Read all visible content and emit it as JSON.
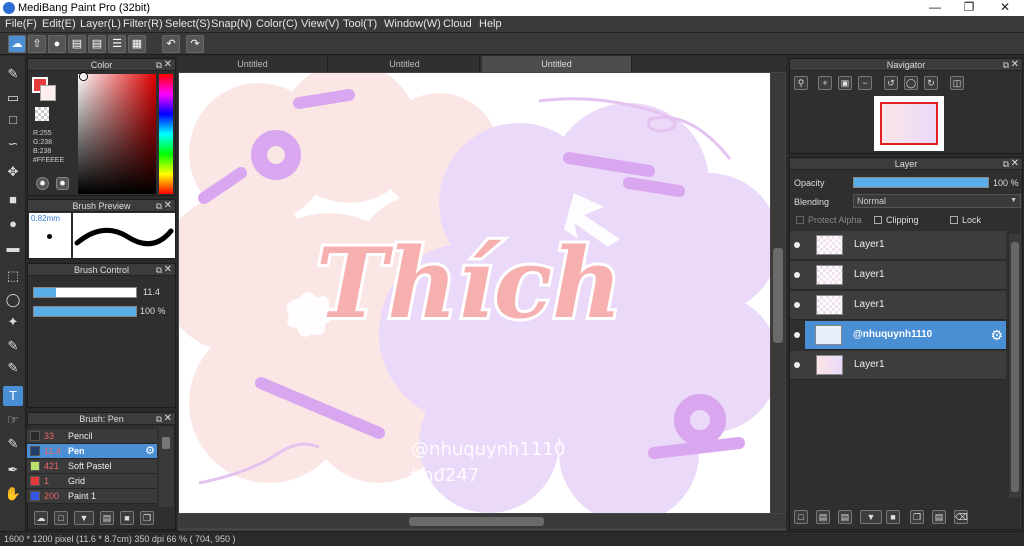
{
  "app": {
    "title": "MediBang Paint Pro (32bit)"
  },
  "menu": [
    "File(F)",
    "Edit(E)",
    "Layer(L)",
    "Filter(R)",
    "Select(S)",
    "Snap(N)",
    "Color(C)",
    "View(V)",
    "Tool(T)",
    "Window(W)",
    "Cloud",
    "Help"
  ],
  "tabs": [
    "Untitled",
    "Untitled",
    "Untitled"
  ],
  "color_panel": {
    "title": "Color",
    "r": "R:255",
    "g": "G:238",
    "b": "B:238",
    "hex": "#FFEEEE",
    "fg": "#ffeeee",
    "primary": "#e83c3c"
  },
  "brush_preview": {
    "title": "Brush Preview",
    "size": "0.82mm"
  },
  "brush_control": {
    "title": "Brush Control",
    "size_value": "11.4",
    "opacity_value": "100 %"
  },
  "brush_list": {
    "title": "Brush: Pen",
    "items": [
      {
        "num": "33",
        "label": "Pencil",
        "color": "#2a2a2a"
      },
      {
        "num": "11.4",
        "label": "Pen",
        "color": "#1e3f6a"
      },
      {
        "num": "421",
        "label": "Soft Pastel",
        "color": "#b8e06a"
      },
      {
        "num": "1",
        "label": "Grid",
        "color": "#e23a3a"
      },
      {
        "num": "200",
        "label": "Paint 1",
        "color": "#3a55e0"
      }
    ]
  },
  "navigator": {
    "title": "Navigator"
  },
  "layer_panel": {
    "title": "Layer",
    "opacity_label": "Opacity",
    "opacity_value": "100 %",
    "blending_label": "Blending",
    "blending_value": "Normal",
    "protect_alpha": "Protect Alpha",
    "clipping": "Clipping",
    "lock": "Lock",
    "layers": [
      "Layer1",
      "Layer1",
      "Layer1",
      "@nhuquynh1110",
      "Layer1"
    ]
  },
  "artwork": {
    "main_text": "Thích",
    "credit_line1": "@nhuquynh1110",
    "credit_line2": "#hđ247"
  },
  "status": "1600 * 1200 pixel   (11.6 * 8.7cm)   350 dpi   66 %   ( 704, 950 )",
  "colors": {
    "accent": "#4a8fd4",
    "panel_bg": "#2f2f2f",
    "lavender": "#d8a6f0",
    "pink": "#f4a6a6"
  }
}
